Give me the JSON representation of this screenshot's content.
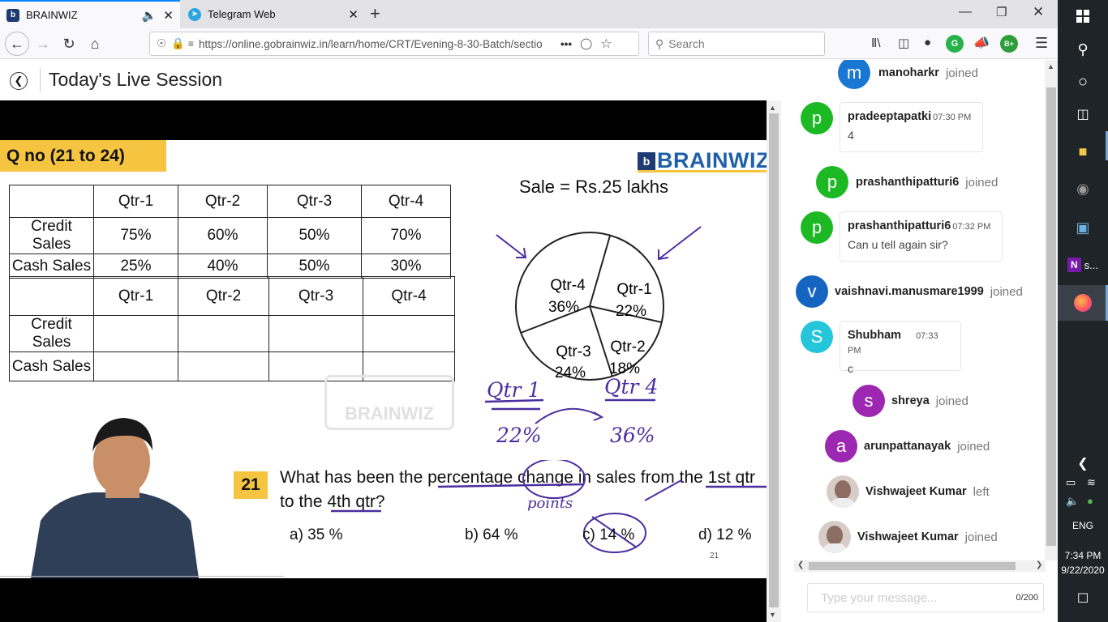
{
  "browser": {
    "tabs": [
      {
        "title": "BRAINWIZ",
        "active": true
      },
      {
        "title": "Telegram Web",
        "active": false
      }
    ],
    "url": "https://online.gobrainwiz.in/learn/home/CRT/Evening-8-30-Batch/sectio",
    "search_placeholder": "Search"
  },
  "page": {
    "title": "Today's Live Session"
  },
  "slide": {
    "banner": "Q no (21 to 24)",
    "brand": "BRAINWIZ",
    "watermark": "BRAINWIZ",
    "table1": {
      "headers": [
        "",
        "Qtr-1",
        "Qtr-2",
        "Qtr-3",
        "Qtr-4"
      ],
      "rows": [
        [
          "Credit Sales",
          "75%",
          "60%",
          "50%",
          "70%"
        ],
        [
          "Cash Sales",
          "25%",
          "40%",
          "50%",
          "30%"
        ]
      ]
    },
    "table2": {
      "headers": [
        "",
        "Qtr-1",
        "Qtr-2",
        "Qtr-3",
        "Qtr-4"
      ],
      "rows": [
        [
          "Credit Sales",
          "",
          "",
          "",
          ""
        ],
        [
          "Cash Sales",
          "",
          "",
          "",
          ""
        ]
      ]
    },
    "pie_title": "Sale = Rs.25 lakhs",
    "pie": [
      {
        "label": "Qtr-1",
        "value": "22%"
      },
      {
        "label": "Qtr-2",
        "value": "18%"
      },
      {
        "label": "Qtr-3",
        "value": "24%"
      },
      {
        "label": "Qtr-4",
        "value": "36%"
      }
    ],
    "handwriting": {
      "q1": "Qtr 1",
      "q4": "Qtr 4",
      "v1": "22%",
      "v4": "36%",
      "points": "points"
    },
    "question_no": "21",
    "question_line1": "What has been the percentage change in sales from the 1st qtr",
    "question_line2": "to the 4th qtr?",
    "options": [
      "a) 35 %",
      "b) 64 %",
      "c) 14 %",
      "d) 12 %"
    ],
    "page_num": "21"
  },
  "chat": {
    "messages": [
      {
        "type": "join",
        "avatar": "m",
        "color": "#1976d2",
        "user": "manoharkr",
        "status": "joined"
      },
      {
        "type": "msg",
        "avatar": "p",
        "color": "#1db924",
        "user": "pradeeptapatki",
        "time": "07:30 PM",
        "text": "4"
      },
      {
        "type": "join",
        "avatar": "p",
        "color": "#1db924",
        "user": "prashanthipatturi6",
        "status": "joined"
      },
      {
        "type": "msg",
        "avatar": "p",
        "color": "#1db924",
        "user": "prashanthipatturi6",
        "time": "07:32 PM",
        "text": "Can u tell again sir?"
      },
      {
        "type": "join",
        "avatar": "v",
        "color": "#1565c0",
        "user": "vaishnavi.manusmare1999",
        "status": "joined"
      },
      {
        "type": "msg",
        "avatar": "S",
        "color": "#26c6da",
        "user": "Shubham",
        "time": "07:33 PM",
        "text": "c"
      },
      {
        "type": "join",
        "avatar": "s",
        "color": "#9c27b0",
        "user": "shreya",
        "status": "joined"
      },
      {
        "type": "join",
        "avatar": "a",
        "color": "#9c27b0",
        "user": "arunpattanayak",
        "status": "joined"
      },
      {
        "type": "join",
        "avatar": "photo",
        "color": "#8d6e63",
        "user": "Vishwajeet Kumar",
        "status": "left"
      },
      {
        "type": "join",
        "avatar": "photo",
        "color": "#8d6e63",
        "user": "Vishwajeet Kumar",
        "status": "joined"
      }
    ],
    "input_placeholder": "Type your message...",
    "char_count": "0/200"
  },
  "taskbar": {
    "onenote_label": "s...",
    "lang": "ENG",
    "time": "7:34 PM",
    "date": "9/22/2020"
  },
  "colors": {
    "accent": "#0a84ff",
    "banner": "#f5c542",
    "brand": "#1f5fa8",
    "ink": "#4b2fa0"
  }
}
